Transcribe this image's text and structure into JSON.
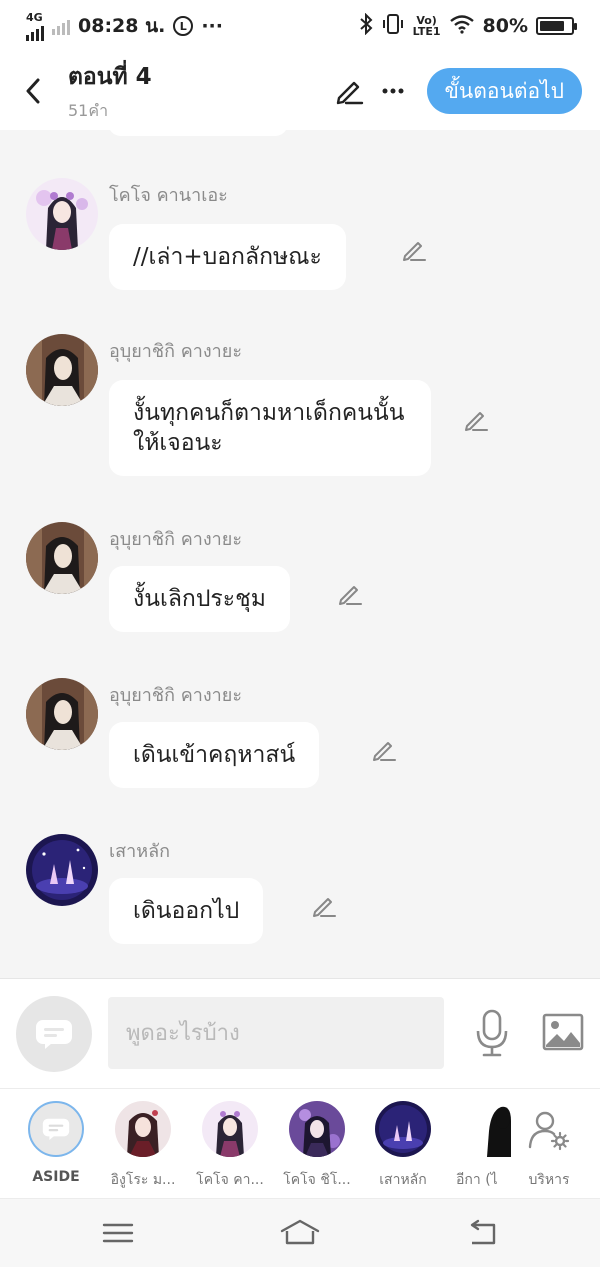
{
  "status_bar": {
    "network": "4G",
    "time": "08:28 น.",
    "dots": "···",
    "volte": "Vo)",
    "lte": "LTE1",
    "battery": "80%",
    "battery_level": 0.8
  },
  "header": {
    "title": "ตอนที่ 4",
    "word_count": "51คำ",
    "next_label": "ขั้นตอนต่อไป"
  },
  "messages": [
    {
      "sender": "โคโจ คานาเอะ",
      "text": "//เล่า+บอกลักษณะ",
      "avatar": "kanae"
    },
    {
      "sender": "อุบุยาชิกิ คางายะ",
      "text": "งั้นทุกคนก็ตามหาเด็กคนนั้นให้เจอนะ",
      "avatar": "kagaya"
    },
    {
      "sender": "อุบุยาชิกิ คางายะ",
      "text": "งั้นเลิกประชุม",
      "avatar": "kagaya"
    },
    {
      "sender": "อุบุยาชิกิ คางายะ",
      "text": "เดินเข้าคฤหาสน์",
      "avatar": "kagaya"
    },
    {
      "sender": "เสาหลัก",
      "text": "เดินออกไป",
      "avatar": "pillar"
    }
  ],
  "input": {
    "placeholder": "พูดอะไรบ้าง"
  },
  "characters": [
    {
      "name": "ASIDE"
    },
    {
      "name": "อิงูโระ ม..."
    },
    {
      "name": "โคโจ คา..."
    },
    {
      "name": "โคโจ ชิโ..."
    },
    {
      "name": "เสาหลัก"
    },
    {
      "name": "อีกา (ไ"
    },
    {
      "name": "บริหาร"
    }
  ],
  "colors": {
    "accent": "#54a9f0",
    "background": "#f5f5f5",
    "bubble": "#ffffff"
  }
}
